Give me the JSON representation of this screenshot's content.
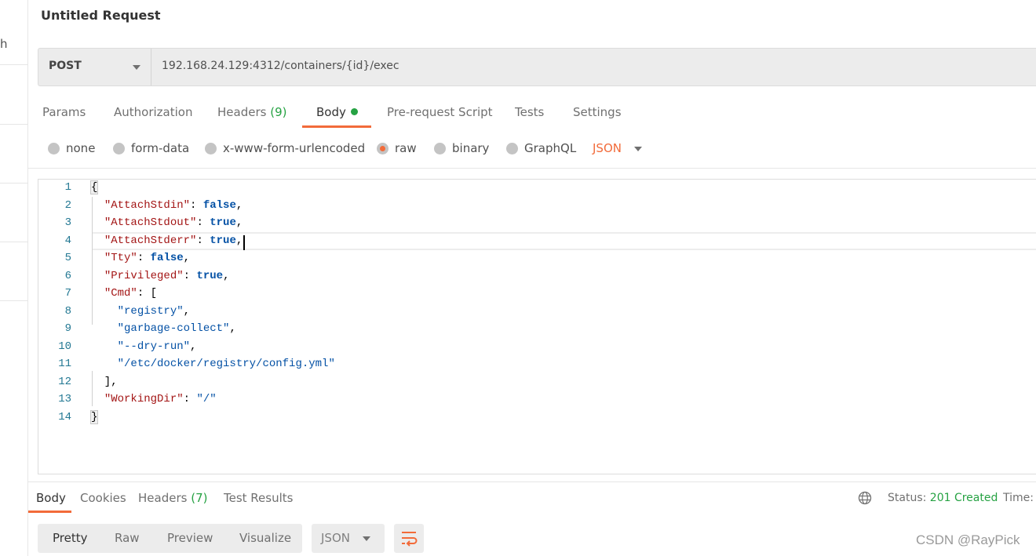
{
  "sidebar": {
    "partial_text": "h"
  },
  "request": {
    "title": "Untitled Request",
    "method": "POST",
    "url": "192.168.24.129:4312/containers/{id}/exec"
  },
  "request_tabs": [
    {
      "label": "Params"
    },
    {
      "label": "Authorization"
    },
    {
      "label": "Headers",
      "count": "(9)"
    },
    {
      "label": "Body",
      "active": true
    },
    {
      "label": "Pre-request Script"
    },
    {
      "label": "Tests"
    },
    {
      "label": "Settings"
    }
  ],
  "body_types": [
    {
      "label": "none"
    },
    {
      "label": "form-data"
    },
    {
      "label": "x-www-form-urlencoded"
    },
    {
      "label": "raw",
      "selected": true
    },
    {
      "label": "binary"
    },
    {
      "label": "GraphQL"
    }
  ],
  "body_language": "JSON",
  "editor": {
    "active_line": 4,
    "lines": [
      [
        [
          "{",
          "brace"
        ]
      ],
      [
        [
          "  ",
          ""
        ],
        [
          "\"AttachStdin\"",
          "k"
        ],
        [
          ": ",
          ""
        ],
        [
          "false",
          "b"
        ],
        [
          ",",
          ""
        ]
      ],
      [
        [
          "  ",
          ""
        ],
        [
          "\"AttachStdout\"",
          "k"
        ],
        [
          ": ",
          ""
        ],
        [
          "true",
          "b"
        ],
        [
          ",",
          ""
        ]
      ],
      [
        [
          "  ",
          ""
        ],
        [
          "\"AttachStderr\"",
          "k"
        ],
        [
          ": ",
          ""
        ],
        [
          "true",
          "b"
        ],
        [
          ",",
          ""
        ]
      ],
      [
        [
          "  ",
          ""
        ],
        [
          "\"Tty\"",
          "k"
        ],
        [
          ": ",
          ""
        ],
        [
          "false",
          "b"
        ],
        [
          ",",
          ""
        ]
      ],
      [
        [
          "  ",
          ""
        ],
        [
          "\"Privileged\"",
          "k"
        ],
        [
          ": ",
          ""
        ],
        [
          "true",
          "b"
        ],
        [
          ",",
          ""
        ]
      ],
      [
        [
          "  ",
          ""
        ],
        [
          "\"Cmd\"",
          "k"
        ],
        [
          ": [",
          ""
        ]
      ],
      [
        [
          "    ",
          ""
        ],
        [
          "\"registry\"",
          "s"
        ],
        [
          ",",
          ""
        ]
      ],
      [
        [
          "    ",
          ""
        ],
        [
          "\"garbage-collect\"",
          "s"
        ],
        [
          ",",
          ""
        ]
      ],
      [
        [
          "    ",
          ""
        ],
        [
          "\"--dry-run\"",
          "s"
        ],
        [
          ",",
          ""
        ]
      ],
      [
        [
          "    ",
          ""
        ],
        [
          "\"/etc/docker/registry/config.yml\"",
          "s"
        ]
      ],
      [
        [
          "  ],",
          ""
        ]
      ],
      [
        [
          "  ",
          ""
        ],
        [
          "\"WorkingDir\"",
          "k"
        ],
        [
          ": ",
          ""
        ],
        [
          "\"/\"",
          "s"
        ]
      ],
      [
        [
          "}",
          "brace"
        ]
      ]
    ]
  },
  "response_tabs": [
    {
      "label": "Body",
      "active": true
    },
    {
      "label": "Cookies"
    },
    {
      "label": "Headers",
      "count": "(7)"
    },
    {
      "label": "Test Results"
    }
  ],
  "response_status": {
    "label": "Status:",
    "value": "201 Created",
    "time_label": "Time:"
  },
  "view_modes": [
    "Pretty",
    "Raw",
    "Preview",
    "Visualize"
  ],
  "response_format": "JSON",
  "watermark": "CSDN @RayPick",
  "colors": {
    "accent": "#f26b3a",
    "success": "#26a243",
    "json_key": "#a31515",
    "json_value": "#0451a5",
    "line_number": "#237893"
  }
}
